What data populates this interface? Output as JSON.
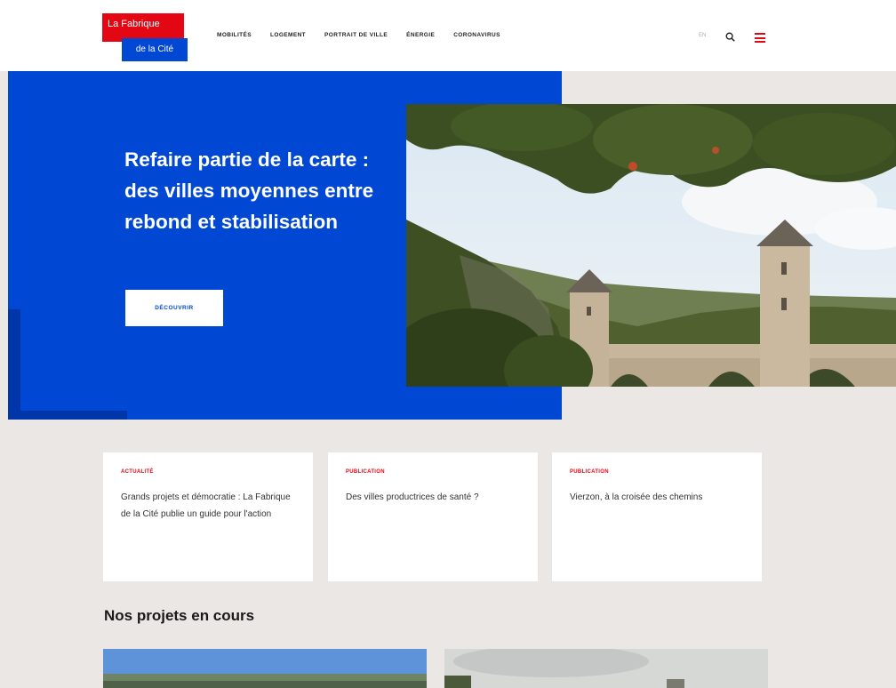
{
  "logo": {
    "line1": "La Fabrique",
    "line2": "de la Cité"
  },
  "nav": {
    "items": [
      "MOBILITÉS",
      "LOGEMENT",
      "PORTRAIT DE VILLE",
      "ÉNERGIE",
      "CORONAVIRUS"
    ],
    "lang": "EN",
    "search_icon": "search-icon",
    "menu_icon": "hamburger-menu-icon"
  },
  "hero": {
    "title": "Refaire partie de la carte : des villes moyennes entre rebond et stabilisation",
    "button": "DÉCOUVRIR"
  },
  "cards": [
    {
      "category": "ACTUALITÉ",
      "text": "Grands projets et démocratie : La Fabrique de la Cité publie un guide pour l'action"
    },
    {
      "category": "PUBLICATION",
      "text": "Des villes productrices de santé ?"
    },
    {
      "category": "PUBLICATION",
      "text": "Vierzon, à la croisée des chemins"
    }
  ],
  "projects": {
    "title": "Nos projets en cours"
  },
  "colors": {
    "brand_red": "#e30613",
    "brand_blue": "#0047d4",
    "background_gray": "#ebe7e5"
  }
}
